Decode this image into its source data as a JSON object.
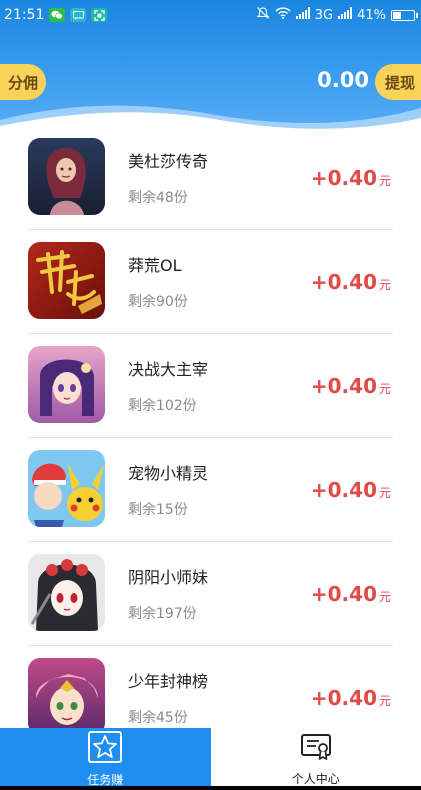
{
  "status_bar": {
    "time": "21:51",
    "network": "3G",
    "battery": "41%",
    "battery_level": 0.41
  },
  "header": {
    "left_button": "分佣",
    "balance": "0.00",
    "right_button": "提现"
  },
  "tasks": [
    {
      "name": "美杜莎传奇",
      "remaining": "剩余48份",
      "reward": "+0.40",
      "unit": "元",
      "icon": "game-medusa-legend-icon"
    },
    {
      "name": "莽荒OL",
      "remaining": "剩余90份",
      "reward": "+0.40",
      "unit": "元",
      "icon": "game-manghuang-icon"
    },
    {
      "name": "决战大主宰",
      "remaining": "剩余102份",
      "reward": "+0.40",
      "unit": "元",
      "icon": "game-juezhan-icon"
    },
    {
      "name": "宠物小精灵",
      "remaining": "剩余15份",
      "reward": "+0.40",
      "unit": "元",
      "icon": "game-pokemon-icon"
    },
    {
      "name": "阴阳小师妹",
      "remaining": "剩余197份",
      "reward": "+0.40",
      "unit": "元",
      "icon": "game-yinyang-icon"
    },
    {
      "name": "少年封神榜",
      "remaining": "剩余45份",
      "reward": "+0.40",
      "unit": "元",
      "icon": "game-fengshen-icon"
    }
  ],
  "bottom_nav": {
    "tabs": [
      {
        "label": "任务赚",
        "icon": "star-icon",
        "active": true
      },
      {
        "label": "个人中心",
        "icon": "certificate-icon",
        "active": false
      }
    ]
  },
  "colors": {
    "header_blue": "#1a86e0",
    "accent_yellow": "#f9d25a",
    "reward_red": "#e24a4a",
    "nav_active": "#1e8ef0"
  }
}
